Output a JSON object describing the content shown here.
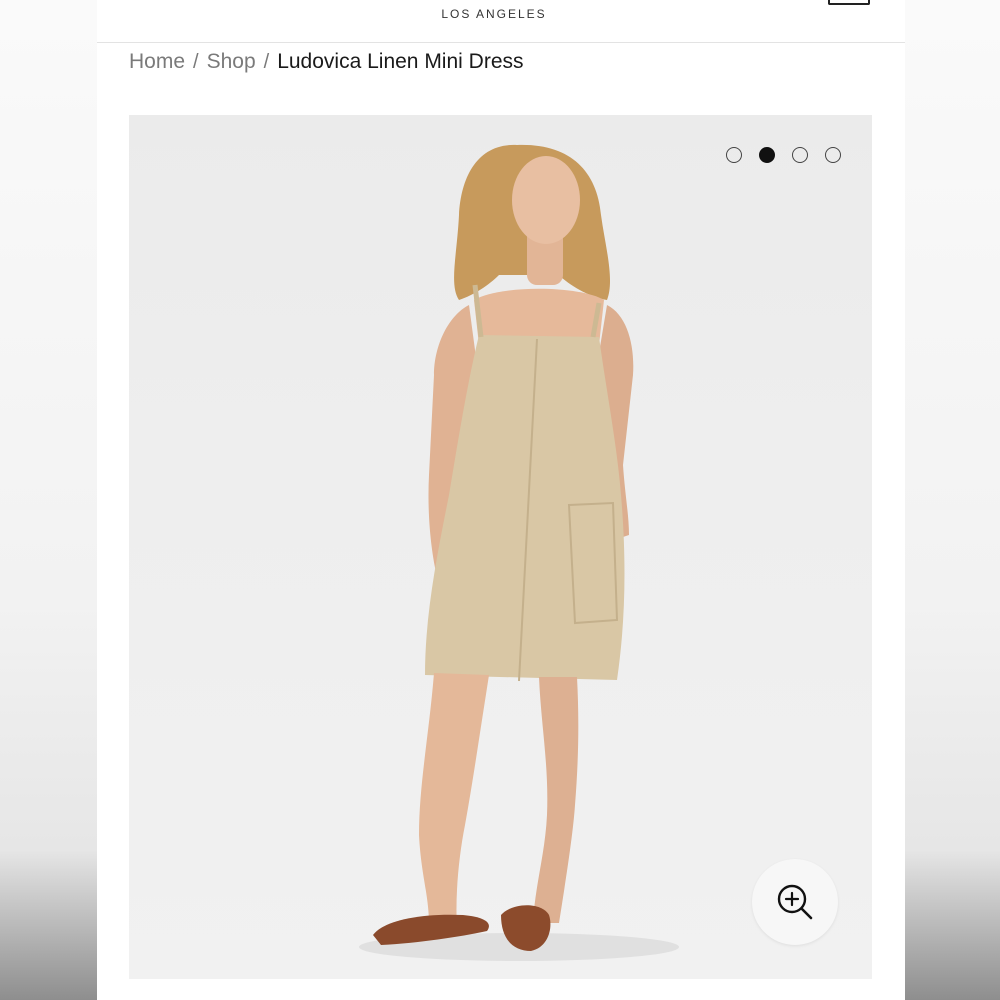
{
  "header": {
    "brand_subtitle": "LOS ANGELES",
    "cart_icon": "bag-icon"
  },
  "breadcrumb": {
    "items": [
      {
        "label": "Home"
      },
      {
        "label": "Shop"
      }
    ],
    "separator": "/",
    "current": "Ludovica Linen Mini Dress"
  },
  "gallery": {
    "image_alt_subject": "model wearing linen mini dress",
    "slide_count": 4,
    "active_slide": 2,
    "zoom_icon": "zoom-in-icon"
  }
}
